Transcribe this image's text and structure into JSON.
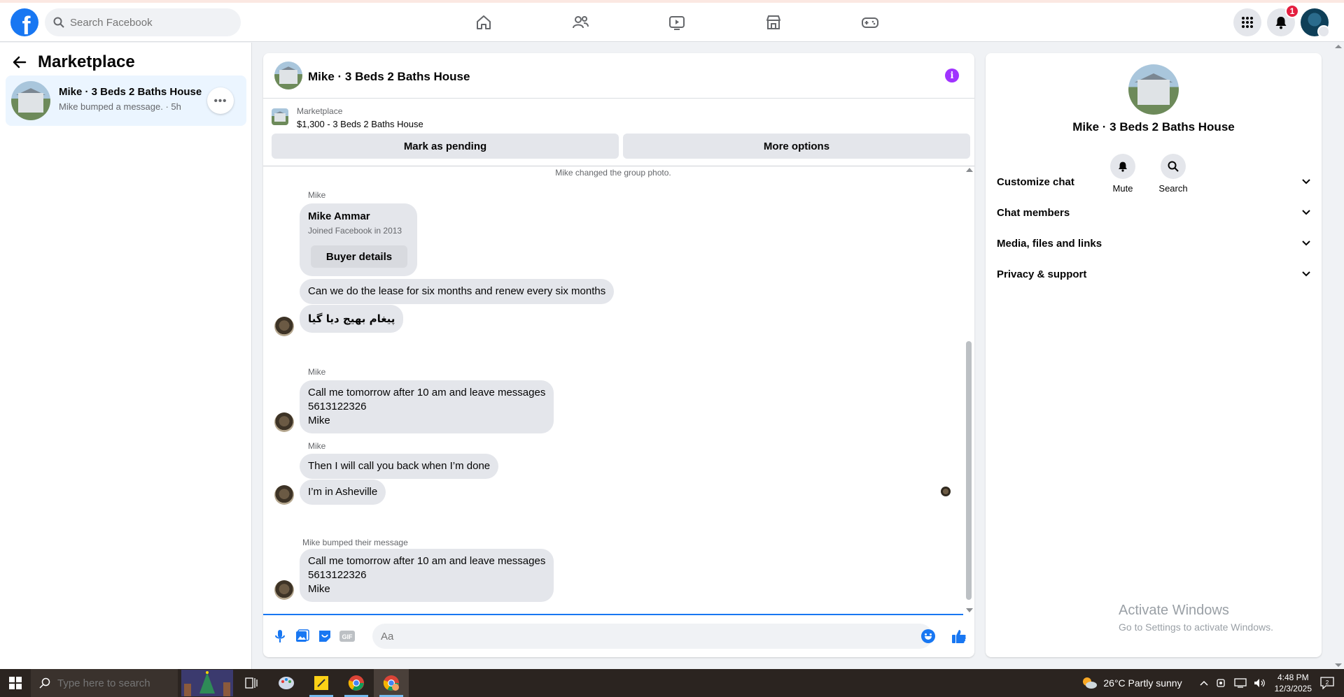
{
  "topnav": {
    "search_placeholder": "Search Facebook",
    "notification_count": "1",
    "accent_color": "#1877f2"
  },
  "sidebar": {
    "title": "Marketplace",
    "conversation": {
      "name": "Mike · 3 Beds 2 Baths House",
      "subtitle": "Mike bumped a message. · 5h"
    }
  },
  "chat": {
    "title": "Mike · 3 Beds 2 Baths House",
    "listing_label": "Marketplace",
    "listing_price": "$1,300 - 3 Beds 2 Baths House",
    "mark_pending_label": "Mark as pending",
    "more_options_label": "More options",
    "system_note": "Mike changed the group photo.",
    "buyer": {
      "sender": "Mike",
      "name": "Mike Ammar",
      "joined": "Joined Facebook in 2013",
      "button": "Buyer details"
    },
    "messages": [
      {
        "text": "Can we do the lease for six months and renew every six months"
      },
      {
        "text": "پیغام بھیج دیا گیا"
      },
      {
        "sender": "Mike",
        "lines": [
          "Call me tomorrow after 10 am and leave messages",
          "5613122326",
          "Mike"
        ]
      },
      {
        "sender": "Mike",
        "text": "Then I will call you back when I’m done"
      },
      {
        "text": "I’m in Asheville"
      },
      {
        "note": "Mike bumped their message",
        "lines": [
          "Call me tomorrow after 10 am and leave messages",
          "5613122326",
          "Mike"
        ]
      }
    ],
    "compose_placeholder": "Aa"
  },
  "rpanel": {
    "title": "Mike · 3 Beds 2 Baths House",
    "mute_label": "Mute",
    "search_label": "Search",
    "sections": [
      "Customize chat",
      "Chat members",
      "Media, files and links",
      "Privacy & support"
    ],
    "watermark_title": "Activate Windows",
    "watermark_sub": "Go to Settings to activate Windows."
  },
  "taskbar": {
    "search_placeholder": "Type here to search",
    "weather": "26°C  Partly sunny",
    "time": "4:48 PM",
    "date": "12/3/2025"
  }
}
